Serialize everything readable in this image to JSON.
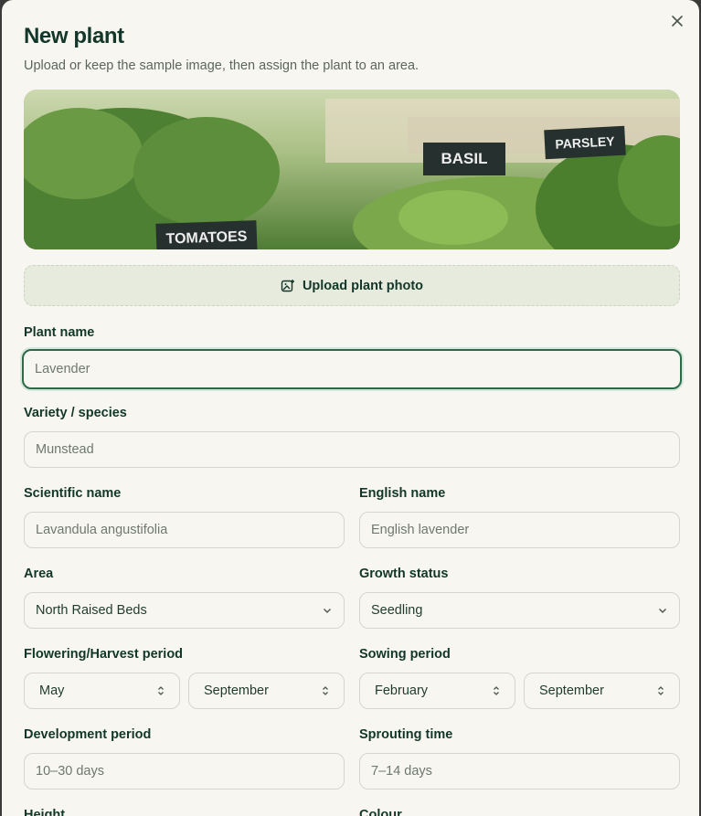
{
  "dialog": {
    "title": "New plant",
    "subtitle": "Upload or keep the sample image, then assign the plant to an area.",
    "close_icon": "close-icon"
  },
  "hero": {
    "labels": [
      "TOMATOES",
      "BASIL",
      "PARSLEY"
    ]
  },
  "upload": {
    "label": "Upload plant photo",
    "icon": "image-add-icon"
  },
  "form": {
    "plant_name": {
      "label": "Plant name",
      "placeholder": "Lavender"
    },
    "variety": {
      "label": "Variety / species",
      "placeholder": "Munstead"
    },
    "scientific": {
      "label": "Scientific name",
      "placeholder": "Lavandula angustifolia"
    },
    "english": {
      "label": "English name",
      "placeholder": "English lavender"
    },
    "area": {
      "label": "Area",
      "value": "North Raised Beds"
    },
    "growth": {
      "label": "Growth status",
      "value": "Seedling"
    },
    "flowering": {
      "label": "Flowering/Harvest period",
      "from": "May",
      "to": "September"
    },
    "sowing": {
      "label": "Sowing period",
      "from": "February",
      "to": "September"
    },
    "development": {
      "label": "Development period",
      "placeholder": "10–30 days"
    },
    "sprouting": {
      "label": "Sprouting time",
      "placeholder": "7–14 days"
    },
    "height": {
      "label": "Height"
    },
    "colour": {
      "label": "Colour"
    }
  },
  "colors": {
    "accent": "#2d6a4a",
    "title": "#12372a",
    "background": "#f8f6f0"
  }
}
